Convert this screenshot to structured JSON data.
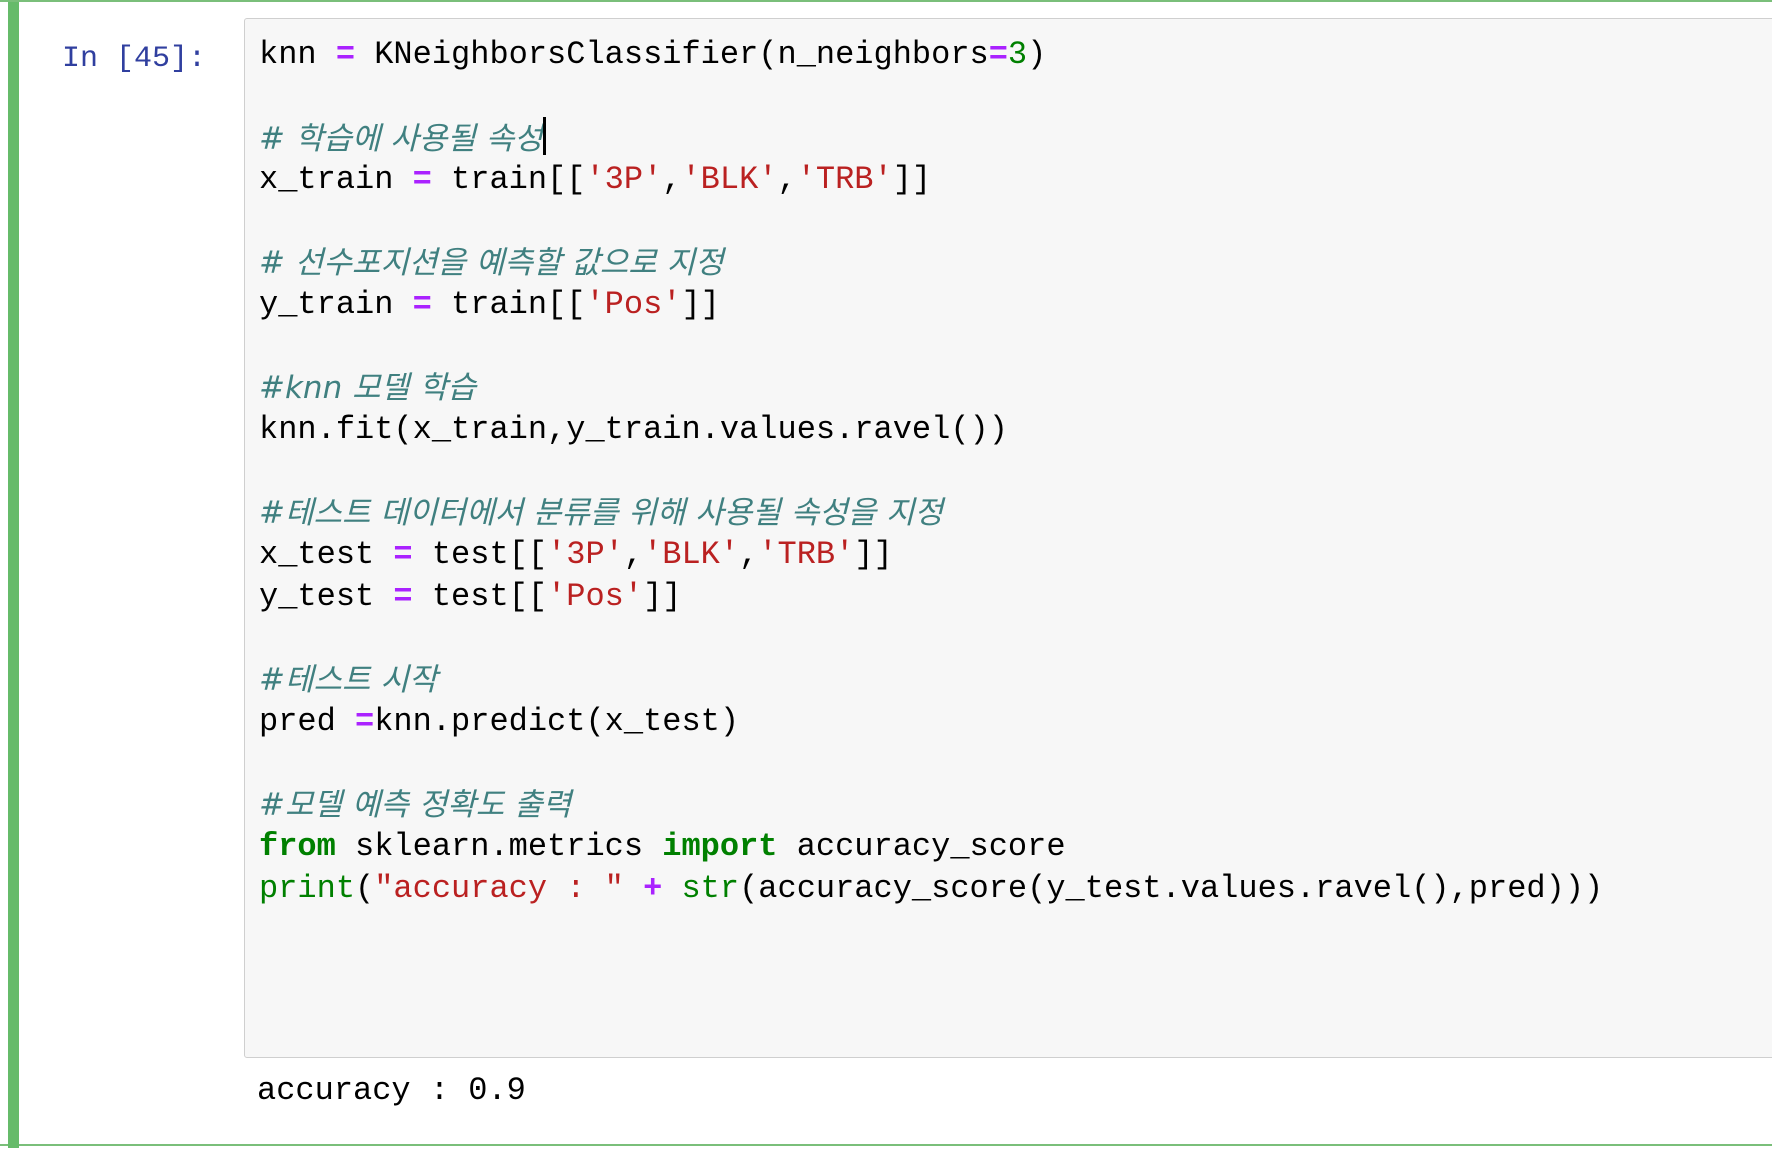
{
  "cell": {
    "prompt": "In [45]:",
    "output": "accuracy : 0.9"
  },
  "code": {
    "l1": [
      "knn",
      "=",
      "KNeighborsClassifier(n_neighbors",
      "=",
      "3",
      ")"
    ],
    "c1": "# 학습에 사용될 속성",
    "l2": [
      "x_train",
      "=",
      "train[[",
      "'3P'",
      ",",
      "'BLK'",
      ",",
      "'TRB'",
      "]]"
    ],
    "c2": "# 선수포지션을 예측할 값으로 지정",
    "l3": [
      "y_train",
      "=",
      "train[[",
      "'Pos'",
      "]]"
    ],
    "c3": "#knn 모델 학습",
    "l4": "knn.fit(x_train,y_train.values.ravel())",
    "c4": "#테스트 데이터에서 분류를 위해 사용될 속성을 지정",
    "l5": [
      "x_test",
      "=",
      "test[[",
      "'3P'",
      ",",
      "'BLK'",
      ",",
      "'TRB'",
      "]]"
    ],
    "l6": [
      "y_test",
      "=",
      "test[[",
      "'Pos'",
      "]]"
    ],
    "c5": "#테스트 시작",
    "l7": [
      "pred ",
      "=",
      "knn.predict(x_test)"
    ],
    "c6": "#모델 예측 정확도 출력",
    "l8": [
      "from",
      "sklearn.metrics",
      "import",
      "accuracy_score"
    ],
    "l9": [
      "print",
      "(",
      "\"accuracy : \"",
      "+",
      "str",
      "(accuracy_score(y_test.values.ravel(),pred)))"
    ]
  },
  "colors": {
    "cell_border_selected": "#66bb6a",
    "prompt": "#303f9f",
    "keyword": "#008000",
    "operator": "#aa22ff",
    "string": "#ba2121",
    "comment": "#408080",
    "input_background": "#f7f7f7"
  }
}
